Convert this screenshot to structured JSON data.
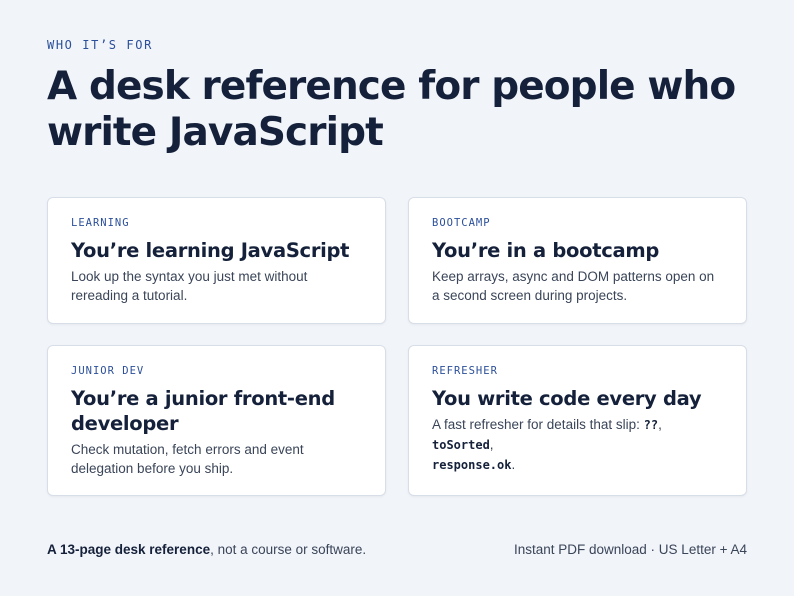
{
  "section": {
    "eyebrow": "WHO IT’S FOR",
    "headline": "A desk reference for people who write JavaScript"
  },
  "cards": [
    {
      "tag": "LEARNING",
      "title": "You’re learning JavaScript",
      "description": "Look up the syntax you just met without rereading a tutorial."
    },
    {
      "tag": "BOOTCAMP",
      "title": "You’re in a bootcamp",
      "description": "Keep arrays, async and DOM patterns open on a second screen during projects."
    },
    {
      "tag": "JUNIOR DEV",
      "title": "You’re a junior front-end developer",
      "description": "Check mutation, fetch errors and event delegation before you ship."
    },
    {
      "tag": "REFRESHER",
      "title": "You write code every day",
      "description_prefix": "A fast refresher for details that slip: ",
      "code_1": "??",
      "separator_1": ", ",
      "code_2": "toSorted",
      "separator_2": ", ",
      "code_3": "response.ok",
      "description_suffix": "."
    }
  ],
  "footer": {
    "left_bold": "A 13-page desk reference",
    "left_rest": ", not a course or software.",
    "right": "Instant PDF download · US Letter + A4"
  },
  "colors": {
    "background": "#f1f4f9",
    "accent": "#2b4f9a",
    "heading": "#15213a",
    "body_text": "#3a4558",
    "card_background": "#ffffff",
    "card_border": "#d8dee8"
  }
}
